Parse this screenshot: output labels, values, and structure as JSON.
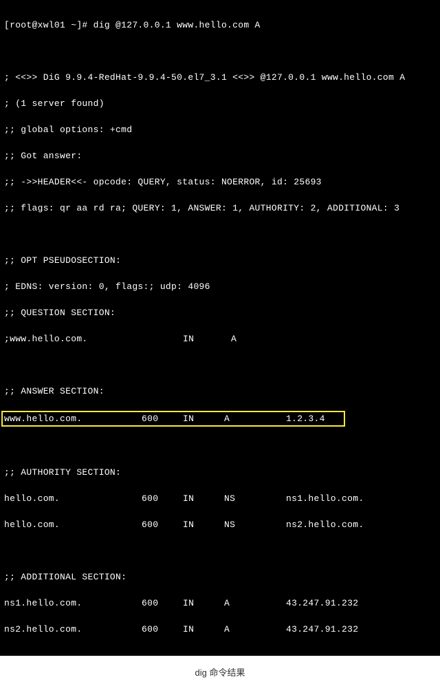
{
  "prompt": "[root@xwl01 ~]# dig @127.0.0.1 www.hello.com A",
  "pre": {
    "banner": "; <<>> DiG 9.9.4-RedHat-9.9.4-50.el7_3.1 <<>> @127.0.0.1 www.hello.com A",
    "servers": "; (1 server found)",
    "global": ";; global options: +cmd",
    "got": ";; Got answer:",
    "header": ";; ->>HEADER<<- opcode: QUERY, status: NOERROR, id: 25693",
    "flags": ";; flags: qr aa rd ra; QUERY: 1, ANSWER: 1, AUTHORITY: 2, ADDITIONAL: 3"
  },
  "opt": {
    "title": ";; OPT PSEUDOSECTION:",
    "edns": "; EDNS: version: 0, flags:; udp: 4096"
  },
  "question": {
    "title": ";; QUESTION SECTION:",
    "name": ";www.hello.com.",
    "class": "IN",
    "type": "A"
  },
  "answer": {
    "title": ";; ANSWER SECTION:",
    "rows": [
      {
        "name": "www.hello.com.",
        "ttl": "600",
        "class": "IN",
        "type": "A",
        "data": "1.2.3.4"
      }
    ]
  },
  "authority": {
    "title": ";; AUTHORITY SECTION:",
    "rows": [
      {
        "name": "hello.com.",
        "ttl": "600",
        "class": "IN",
        "type": "NS",
        "data": "ns1.hello.com."
      },
      {
        "name": "hello.com.",
        "ttl": "600",
        "class": "IN",
        "type": "NS",
        "data": "ns2.hello.com."
      }
    ]
  },
  "additional": {
    "title": ";; ADDITIONAL SECTION:",
    "rows": [
      {
        "name": "ns1.hello.com.",
        "ttl": "600",
        "class": "IN",
        "type": "A",
        "data": "43.247.91.232"
      },
      {
        "name": "ns2.hello.com.",
        "ttl": "600",
        "class": "IN",
        "type": "A",
        "data": "43.247.91.232"
      }
    ]
  },
  "caption": "dig 命令结果"
}
